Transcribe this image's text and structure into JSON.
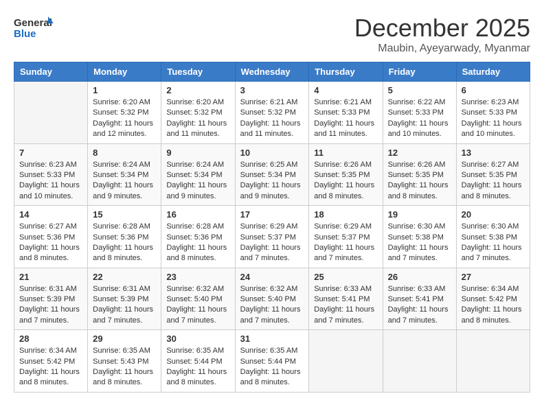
{
  "header": {
    "logo_line1": "General",
    "logo_line2": "Blue",
    "month_title": "December 2025",
    "location": "Maubin, Ayeyarwady, Myanmar"
  },
  "weekdays": [
    "Sunday",
    "Monday",
    "Tuesday",
    "Wednesday",
    "Thursday",
    "Friday",
    "Saturday"
  ],
  "weeks": [
    [
      {
        "day": "",
        "sunrise": "",
        "sunset": "",
        "daylight": ""
      },
      {
        "day": "1",
        "sunrise": "Sunrise: 6:20 AM",
        "sunset": "Sunset: 5:32 PM",
        "daylight": "Daylight: 11 hours and 12 minutes."
      },
      {
        "day": "2",
        "sunrise": "Sunrise: 6:20 AM",
        "sunset": "Sunset: 5:32 PM",
        "daylight": "Daylight: 11 hours and 11 minutes."
      },
      {
        "day": "3",
        "sunrise": "Sunrise: 6:21 AM",
        "sunset": "Sunset: 5:32 PM",
        "daylight": "Daylight: 11 hours and 11 minutes."
      },
      {
        "day": "4",
        "sunrise": "Sunrise: 6:21 AM",
        "sunset": "Sunset: 5:33 PM",
        "daylight": "Daylight: 11 hours and 11 minutes."
      },
      {
        "day": "5",
        "sunrise": "Sunrise: 6:22 AM",
        "sunset": "Sunset: 5:33 PM",
        "daylight": "Daylight: 11 hours and 10 minutes."
      },
      {
        "day": "6",
        "sunrise": "Sunrise: 6:23 AM",
        "sunset": "Sunset: 5:33 PM",
        "daylight": "Daylight: 11 hours and 10 minutes."
      }
    ],
    [
      {
        "day": "7",
        "sunrise": "Sunrise: 6:23 AM",
        "sunset": "Sunset: 5:33 PM",
        "daylight": "Daylight: 11 hours and 10 minutes."
      },
      {
        "day": "8",
        "sunrise": "Sunrise: 6:24 AM",
        "sunset": "Sunset: 5:34 PM",
        "daylight": "Daylight: 11 hours and 9 minutes."
      },
      {
        "day": "9",
        "sunrise": "Sunrise: 6:24 AM",
        "sunset": "Sunset: 5:34 PM",
        "daylight": "Daylight: 11 hours and 9 minutes."
      },
      {
        "day": "10",
        "sunrise": "Sunrise: 6:25 AM",
        "sunset": "Sunset: 5:34 PM",
        "daylight": "Daylight: 11 hours and 9 minutes."
      },
      {
        "day": "11",
        "sunrise": "Sunrise: 6:26 AM",
        "sunset": "Sunset: 5:35 PM",
        "daylight": "Daylight: 11 hours and 8 minutes."
      },
      {
        "day": "12",
        "sunrise": "Sunrise: 6:26 AM",
        "sunset": "Sunset: 5:35 PM",
        "daylight": "Daylight: 11 hours and 8 minutes."
      },
      {
        "day": "13",
        "sunrise": "Sunrise: 6:27 AM",
        "sunset": "Sunset: 5:35 PM",
        "daylight": "Daylight: 11 hours and 8 minutes."
      }
    ],
    [
      {
        "day": "14",
        "sunrise": "Sunrise: 6:27 AM",
        "sunset": "Sunset: 5:36 PM",
        "daylight": "Daylight: 11 hours and 8 minutes."
      },
      {
        "day": "15",
        "sunrise": "Sunrise: 6:28 AM",
        "sunset": "Sunset: 5:36 PM",
        "daylight": "Daylight: 11 hours and 8 minutes."
      },
      {
        "day": "16",
        "sunrise": "Sunrise: 6:28 AM",
        "sunset": "Sunset: 5:36 PM",
        "daylight": "Daylight: 11 hours and 8 minutes."
      },
      {
        "day": "17",
        "sunrise": "Sunrise: 6:29 AM",
        "sunset": "Sunset: 5:37 PM",
        "daylight": "Daylight: 11 hours and 7 minutes."
      },
      {
        "day": "18",
        "sunrise": "Sunrise: 6:29 AM",
        "sunset": "Sunset: 5:37 PM",
        "daylight": "Daylight: 11 hours and 7 minutes."
      },
      {
        "day": "19",
        "sunrise": "Sunrise: 6:30 AM",
        "sunset": "Sunset: 5:38 PM",
        "daylight": "Daylight: 11 hours and 7 minutes."
      },
      {
        "day": "20",
        "sunrise": "Sunrise: 6:30 AM",
        "sunset": "Sunset: 5:38 PM",
        "daylight": "Daylight: 11 hours and 7 minutes."
      }
    ],
    [
      {
        "day": "21",
        "sunrise": "Sunrise: 6:31 AM",
        "sunset": "Sunset: 5:39 PM",
        "daylight": "Daylight: 11 hours and 7 minutes."
      },
      {
        "day": "22",
        "sunrise": "Sunrise: 6:31 AM",
        "sunset": "Sunset: 5:39 PM",
        "daylight": "Daylight: 11 hours and 7 minutes."
      },
      {
        "day": "23",
        "sunrise": "Sunrise: 6:32 AM",
        "sunset": "Sunset: 5:40 PM",
        "daylight": "Daylight: 11 hours and 7 minutes."
      },
      {
        "day": "24",
        "sunrise": "Sunrise: 6:32 AM",
        "sunset": "Sunset: 5:40 PM",
        "daylight": "Daylight: 11 hours and 7 minutes."
      },
      {
        "day": "25",
        "sunrise": "Sunrise: 6:33 AM",
        "sunset": "Sunset: 5:41 PM",
        "daylight": "Daylight: 11 hours and 7 minutes."
      },
      {
        "day": "26",
        "sunrise": "Sunrise: 6:33 AM",
        "sunset": "Sunset: 5:41 PM",
        "daylight": "Daylight: 11 hours and 7 minutes."
      },
      {
        "day": "27",
        "sunrise": "Sunrise: 6:34 AM",
        "sunset": "Sunset: 5:42 PM",
        "daylight": "Daylight: 11 hours and 8 minutes."
      }
    ],
    [
      {
        "day": "28",
        "sunrise": "Sunrise: 6:34 AM",
        "sunset": "Sunset: 5:42 PM",
        "daylight": "Daylight: 11 hours and 8 minutes."
      },
      {
        "day": "29",
        "sunrise": "Sunrise: 6:35 AM",
        "sunset": "Sunset: 5:43 PM",
        "daylight": "Daylight: 11 hours and 8 minutes."
      },
      {
        "day": "30",
        "sunrise": "Sunrise: 6:35 AM",
        "sunset": "Sunset: 5:44 PM",
        "daylight": "Daylight: 11 hours and 8 minutes."
      },
      {
        "day": "31",
        "sunrise": "Sunrise: 6:35 AM",
        "sunset": "Sunset: 5:44 PM",
        "daylight": "Daylight: 11 hours and 8 minutes."
      },
      {
        "day": "",
        "sunrise": "",
        "sunset": "",
        "daylight": ""
      },
      {
        "day": "",
        "sunrise": "",
        "sunset": "",
        "daylight": ""
      },
      {
        "day": "",
        "sunrise": "",
        "sunset": "",
        "daylight": ""
      }
    ]
  ]
}
